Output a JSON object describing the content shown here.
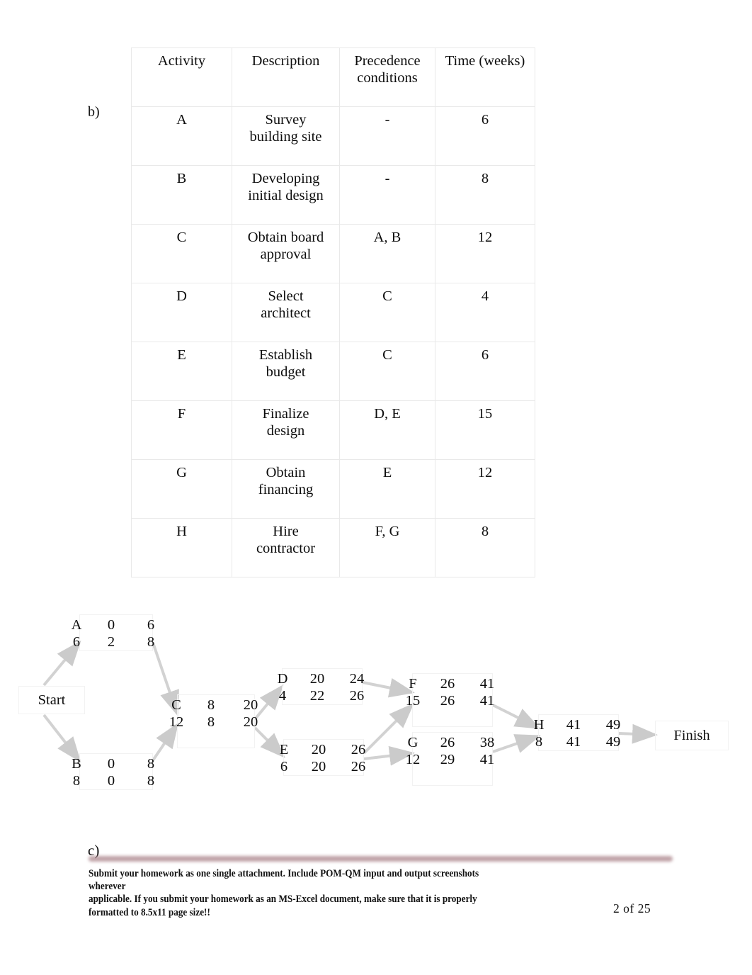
{
  "sections": {
    "label_b": "b)",
    "label_c": "c)"
  },
  "activity_table": {
    "headers": [
      "Activity",
      "Description",
      "Precedence conditions",
      "Time (weeks)"
    ],
    "header_precedence_line1": "Precedence",
    "header_precedence_line2": "conditions",
    "rows": [
      {
        "activity": "A",
        "desc_line1": "Survey",
        "desc_line2": "building site",
        "precedence": "-",
        "time": "6"
      },
      {
        "activity": "B",
        "desc_line1": "Developing",
        "desc_line2": "initial design",
        "precedence": "-",
        "time": "8"
      },
      {
        "activity": "C",
        "desc_line1": "Obtain board",
        "desc_line2": "approval",
        "precedence": "A, B",
        "time": "12"
      },
      {
        "activity": "D",
        "desc_line1": "Select",
        "desc_line2": "architect",
        "precedence": "C",
        "time": "4"
      },
      {
        "activity": "E",
        "desc_line1": "Establish",
        "desc_line2": "budget",
        "precedence": "C",
        "time": "6"
      },
      {
        "activity": "F",
        "desc_line1": "Finalize",
        "desc_line2": "design",
        "precedence": "D, E",
        "time": "15"
      },
      {
        "activity": "G",
        "desc_line1": "Obtain",
        "desc_line2": "financing",
        "precedence": "E",
        "time": "12"
      },
      {
        "activity": "H",
        "desc_line1": "Hire",
        "desc_line2": "contractor",
        "precedence": "F, G",
        "time": "8"
      }
    ]
  },
  "network_diagram": {
    "start_label": "Start",
    "finish_label": "Finish",
    "nodes": {
      "A": {
        "id": "A",
        "duration": "6",
        "es": "0",
        "ef": "6",
        "ls": "2",
        "lf": "8"
      },
      "B": {
        "id": "B",
        "duration": "8",
        "es": "0",
        "ef": "8",
        "ls": "0",
        "lf": "8"
      },
      "C": {
        "id": "C",
        "duration": "12",
        "es": "8",
        "ef": "20",
        "ls": "8",
        "lf": "20"
      },
      "D": {
        "id": "D",
        "duration": "4",
        "es": "20",
        "ef": "24",
        "ls": "22",
        "lf": "26"
      },
      "E": {
        "id": "E",
        "duration": "6",
        "es": "20",
        "ef": "26",
        "ls": "20",
        "lf": "26"
      },
      "F": {
        "id": "F",
        "duration": "15",
        "es": "26",
        "ef": "41",
        "ls": "26",
        "lf": "41"
      },
      "G": {
        "id": "G",
        "duration": "12",
        "es": "26",
        "ef": "38",
        "ls": "29",
        "lf": "41"
      },
      "H": {
        "id": "H",
        "duration": "8",
        "es": "41",
        "ef": "49",
        "ls": "41",
        "lf": "49"
      }
    }
  },
  "footer": {
    "note_line1": "Submit your homework as one single attachment. Include POM-QM input and output screenshots wherever",
    "note_line2": "applicable.     If you submit your homework as an MS-Excel document, make sure that it is properly",
    "note_line3": "formatted to 8.5x11 page size!!",
    "page_number": "2  of  25"
  },
  "colors": {
    "rule": "#a88086",
    "text": "#0d0d0d",
    "border": "#e9e9e9"
  }
}
